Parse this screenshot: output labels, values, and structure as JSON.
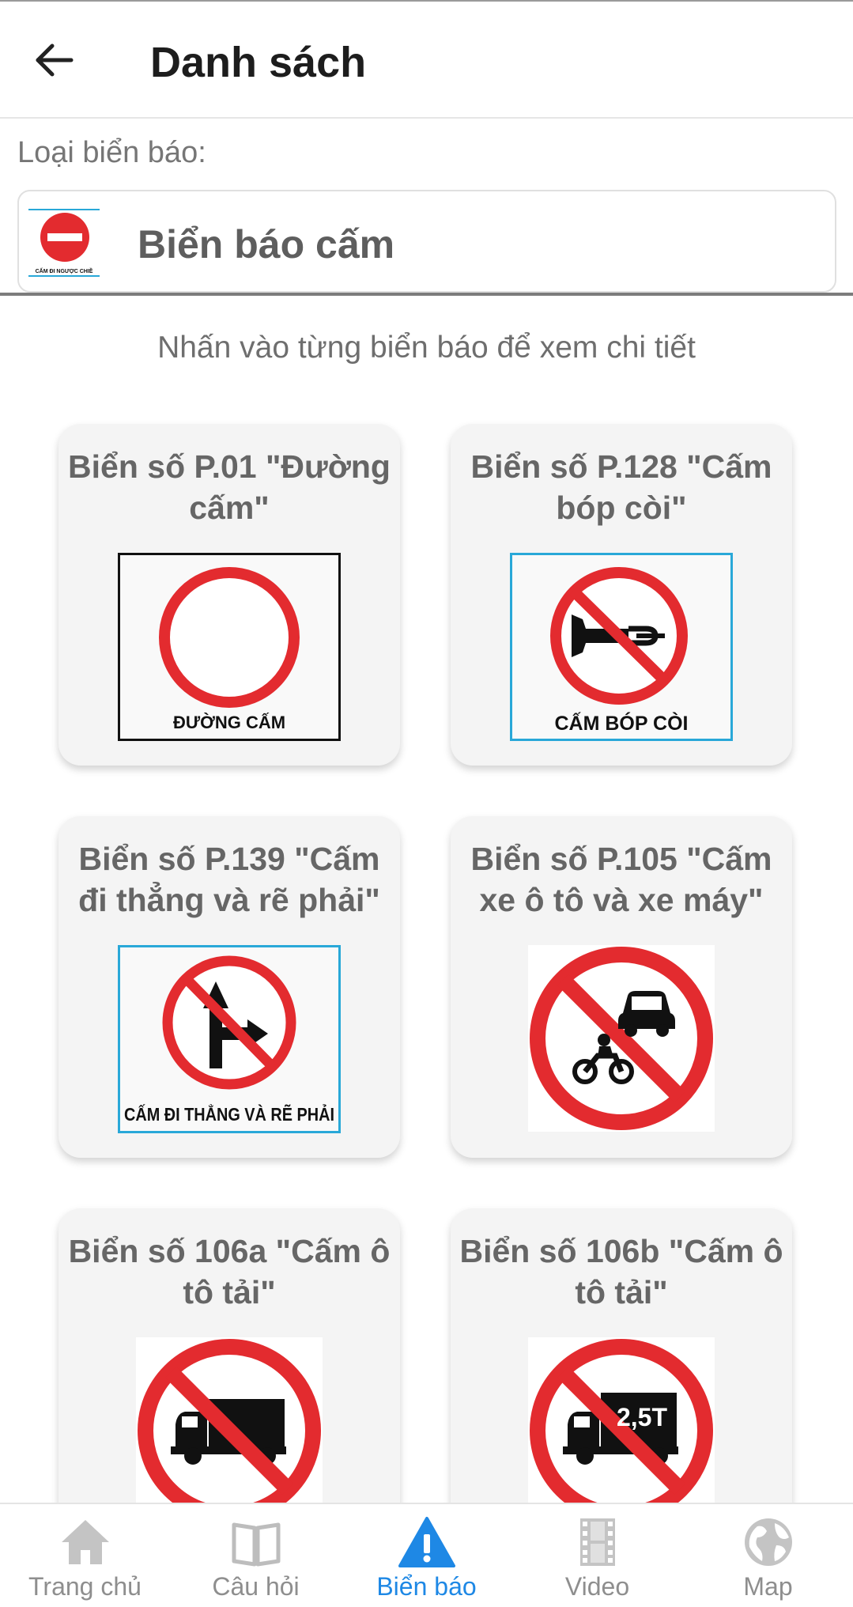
{
  "header": {
    "title": "Danh sách"
  },
  "category": {
    "label": "Loại biển báo:",
    "selected": "Biển báo cấm",
    "thumb_caption": "CẤM ĐI NGƯỢC CHIỀ"
  },
  "hint": "Nhấn vào từng biển báo để xem chi tiết",
  "signs": [
    {
      "title": "Biển số P.01 \"Đường cấm\"",
      "caption": "ĐƯỜNG CẤM",
      "icon": "no-entry-circle"
    },
    {
      "title": "Biển số P.128 \"Cấm bóp còi\"",
      "caption": "CẤM BÓP CÒI",
      "icon": "no-horn"
    },
    {
      "title": "Biển số P.139 \"Cấm đi thẳng và rẽ phải\"",
      "caption": "CẤM ĐI THẲNG VÀ RẼ PHẢI",
      "icon": "no-straight-right"
    },
    {
      "title": "Biển số P.105 \"Cấm xe ô tô và xe máy\"",
      "caption": "",
      "icon": "no-car-motorbike"
    },
    {
      "title": "Biển số 106a \"Cấm ô tô tải\"",
      "caption": "",
      "icon": "no-truck"
    },
    {
      "title": "Biển số 106b \"Cấm ô tô tải\"",
      "caption": "",
      "weight": "2,5T",
      "icon": "no-truck-weight"
    }
  ],
  "nav": {
    "items": [
      {
        "label": "Trang chủ",
        "icon": "home-icon"
      },
      {
        "label": "Câu hỏi",
        "icon": "book-icon"
      },
      {
        "label": "Biển báo",
        "icon": "warning-sign-icon",
        "active": true
      },
      {
        "label": "Video",
        "icon": "film-icon"
      },
      {
        "label": "Map",
        "icon": "globe-icon"
      }
    ]
  },
  "colors": {
    "accent": "#1e88e5",
    "sign_red": "#e32b2f",
    "card_bg": "#f4f4f4",
    "frame_blue": "#29a8d8"
  }
}
